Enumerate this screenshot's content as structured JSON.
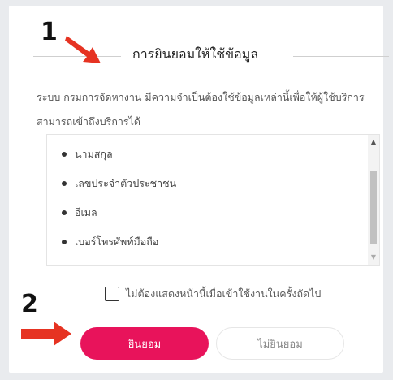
{
  "dialog": {
    "title": "การยินยอมให้ใช้ข้อมูล",
    "description": "ระบบ กรมการจัดหางาน มีความจำเป็นต้องใช้ข้อมูลเหล่านี้เพื่อให้ผู้ใช้บริการสามารถเข้าถึงบริการได้",
    "items": [
      "นามสกุล",
      "เลขประจำตัวประชาชน",
      "อีเมล",
      "เบอร์โทรศัพท์มือถือ"
    ],
    "checkbox_label": "ไม่ต้องแสดงหน้านี้เมื่อเข้าใช้งานในครั้งถัดไป",
    "accept_label": "ยินยอม",
    "decline_label": "ไม่ยินยอม"
  },
  "annotations": {
    "step1": "1",
    "step2": "2",
    "arrow_color": "#e63322"
  },
  "colors": {
    "accent": "#e8135b",
    "background": "#e9ebee"
  }
}
